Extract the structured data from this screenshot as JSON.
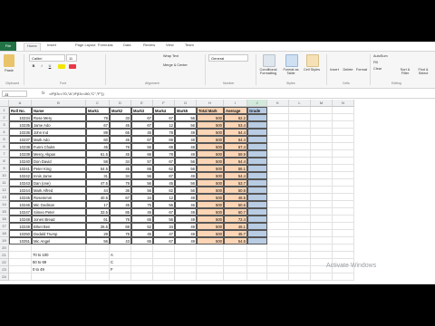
{
  "ribbon_tabs": [
    "File",
    "Home",
    "Insert",
    "Page Layout",
    "Formulas",
    "Data",
    "Review",
    "View",
    "Team"
  ],
  "ribbon": {
    "paste": "Paste",
    "font_name": "Calibri",
    "font_size": "11",
    "wrap_text": "Wrap Text",
    "merge_center": "Merge & Center",
    "number_format": "General",
    "conditional_formatting": "Conditional Formatting",
    "format_as_table": "Format as Table",
    "cell_styles": "Cell Styles",
    "insert": "Insert",
    "delete": "Delete",
    "format": "Format",
    "autosum": "AutoSum",
    "fill": "Fill",
    "clear": "Clear",
    "sort_filter": "Sort & Filter",
    "find_select": "Find & Select",
    "groups": [
      "Clipboard",
      "Font",
      "Alignment",
      "Number",
      "Styles",
      "Cells",
      "Editing"
    ]
  },
  "formula_bar": {
    "name_box": "J3",
    "fx": "fx",
    "formula": "=IF(I3>=70,\"A\",IF(I3>=50,\"C\",\"F\"))"
  },
  "columns": [
    "A",
    "B",
    "C",
    "D",
    "E",
    "F",
    "G",
    "H",
    "I",
    "J",
    "K",
    "L",
    "M",
    "N"
  ],
  "headers": [
    "Roll No.",
    "Name",
    "Mark1",
    "Mark2",
    "Mark3",
    "Mark4",
    "Mark5",
    "Total Mark",
    "Average",
    "Grade"
  ],
  "rows": [
    [
      "10234",
      "Rose Mery",
      "78",
      "33",
      "67",
      "67",
      "56",
      "500",
      "62.2"
    ],
    [
      "10235",
      "Jame Ado",
      "67",
      "45",
      "67",
      "12",
      "56",
      "500",
      "53.4"
    ],
    [
      "10236",
      "John Ind",
      "89",
      "65",
      "45",
      "78",
      "49",
      "500",
      "64.4"
    ],
    [
      "10237",
      "Mark Ado",
      "60",
      "45",
      "67",
      "69",
      "48",
      "500",
      "64.4"
    ],
    [
      "10238",
      "Funni Chuks",
      "45",
      "78",
      "56",
      "69",
      "48",
      "500",
      "67.4"
    ],
    [
      "10239",
      "Mercy Akpan",
      "61.5",
      "45",
      "66",
      "78",
      "49",
      "500",
      "59.9"
    ],
    [
      "10240",
      "Don David",
      "58",
      "34",
      "57",
      "67",
      "56",
      "500",
      "64.4"
    ],
    [
      "10241",
      "Peter King",
      "54.5",
      "45",
      "66",
      "62",
      "56",
      "500",
      "56.1"
    ],
    [
      "10242",
      "Innis Jame",
      "31",
      "34",
      "56",
      "67",
      "49",
      "500",
      "54.4"
    ],
    [
      "10243",
      "Dan (one)",
      "47.5",
      "78",
      "56",
      "45",
      "56",
      "500",
      "53.7"
    ],
    [
      "10244",
      "Mark Alfred",
      "44",
      "36",
      "56",
      "62",
      "56",
      "500",
      "50.8"
    ],
    [
      "10245",
      "Rosemmm",
      "40.5",
      "67",
      "34",
      "12",
      "49",
      "500",
      "46.5"
    ],
    [
      "10246",
      "Mic Gedison",
      "17",
      "45",
      "75",
      "56",
      "46",
      "500",
      "50.6"
    ],
    [
      "10247",
      "Simeo Peter",
      "33.5",
      "85",
      "45",
      "67",
      "49",
      "500",
      "60.7"
    ],
    [
      "10248",
      "Jones Bread",
      "61",
      "78",
      "65",
      "56",
      "49",
      "500",
      "72.4"
    ],
    [
      "10249",
      "Brket Ben",
      "26.5",
      "69",
      "52",
      "34",
      "49",
      "500",
      "46.1"
    ],
    [
      "10250",
      "Dodald Trump",
      "29",
      "78",
      "45",
      "47",
      "49",
      "500",
      "45.7"
    ],
    [
      "10251",
      "Mic Angel",
      "56",
      "43",
      "65",
      "67",
      "49",
      "500",
      "54.6"
    ]
  ],
  "grading": [
    [
      "70 to 100",
      "A"
    ],
    [
      "50 to 69",
      "C"
    ],
    [
      "0 to 49",
      "F"
    ]
  ],
  "row_numbers": [
    "1",
    "2",
    "3",
    "4",
    "5",
    "6",
    "7",
    "8",
    "9",
    "10",
    "11",
    "12",
    "13",
    "14",
    "15",
    "16",
    "17",
    "18",
    "19",
    "20",
    "21",
    "22",
    "23",
    "24",
    "25"
  ],
  "watermark": "Activate Windows",
  "colors": {
    "accent": "#217346",
    "orange": "#fbd5b5",
    "blue": "#b8cce4"
  }
}
